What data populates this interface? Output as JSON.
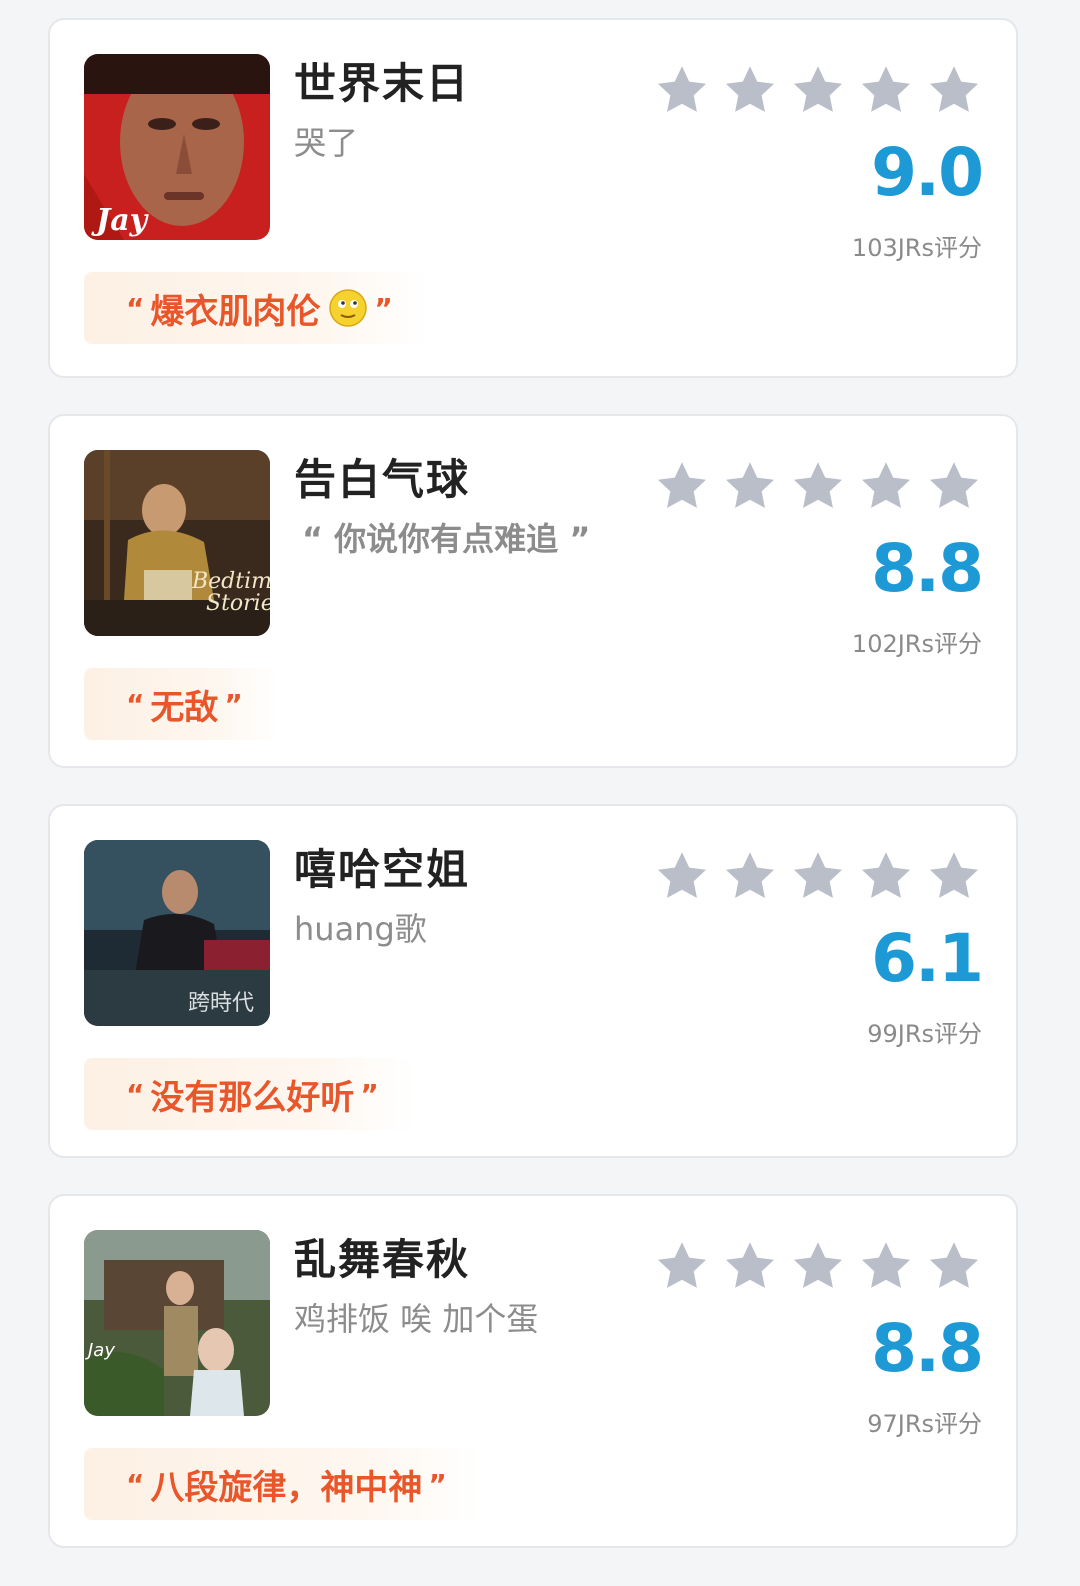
{
  "colors": {
    "score": "#1d9ad6",
    "quote": "#e8562a",
    "star": "#b9bec8",
    "title": "#222222",
    "subtitle": "#8c8c8c"
  },
  "icons": {
    "star": "star-icon",
    "emoji": "smiley-emoji-icon"
  },
  "open_quote": "“",
  "close_quote": "”",
  "songs": [
    {
      "title": "世界末日",
      "subtitle": "哭了",
      "score": "9.0",
      "raters": "103JRs评分",
      "stars": 5,
      "quote": "爆衣肌肉伦",
      "emoji": true
    },
    {
      "title": "告白气球",
      "subtitle": "“ 你说你有点难追 ”",
      "score": "8.8",
      "raters": "102JRs评分",
      "stars": 5,
      "quote": "无敌",
      "emoji": false
    },
    {
      "title": "嘻哈空姐",
      "subtitle": "huang歌",
      "score": "6.1",
      "raters": "99JRs评分",
      "stars": 5,
      "quote": "没有那么好听",
      "emoji": false
    },
    {
      "title": "乱舞春秋",
      "subtitle": "鸡排饭 唉 加个蛋",
      "score": "8.8",
      "raters": "97JRs评分",
      "stars": 5,
      "quote": "八段旋律，神中神",
      "emoji": false
    }
  ]
}
